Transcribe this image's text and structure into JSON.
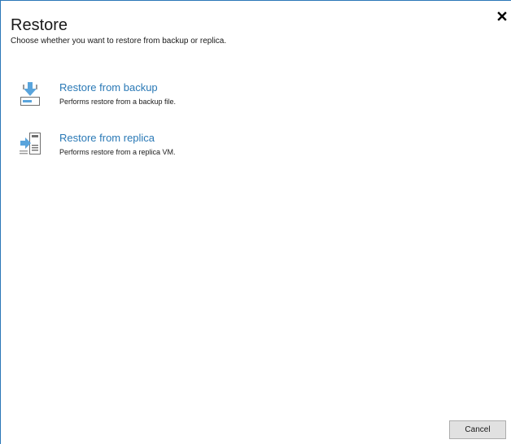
{
  "dialog": {
    "title": "Restore",
    "subtitle": "Choose whether you want to restore from backup or replica."
  },
  "options": [
    {
      "label": "Restore from backup",
      "description": "Performs restore from a backup file.",
      "icon": "restore-from-backup-icon"
    },
    {
      "label": "Restore from replica",
      "description": "Performs restore from a replica VM.",
      "icon": "restore-from-replica-icon"
    }
  ],
  "buttons": {
    "cancel_label": "Cancel",
    "close_icon": "close-icon"
  },
  "colors": {
    "link": "#2a79b6",
    "icon_blue": "#59a4dc",
    "border": "#2b78b8"
  }
}
